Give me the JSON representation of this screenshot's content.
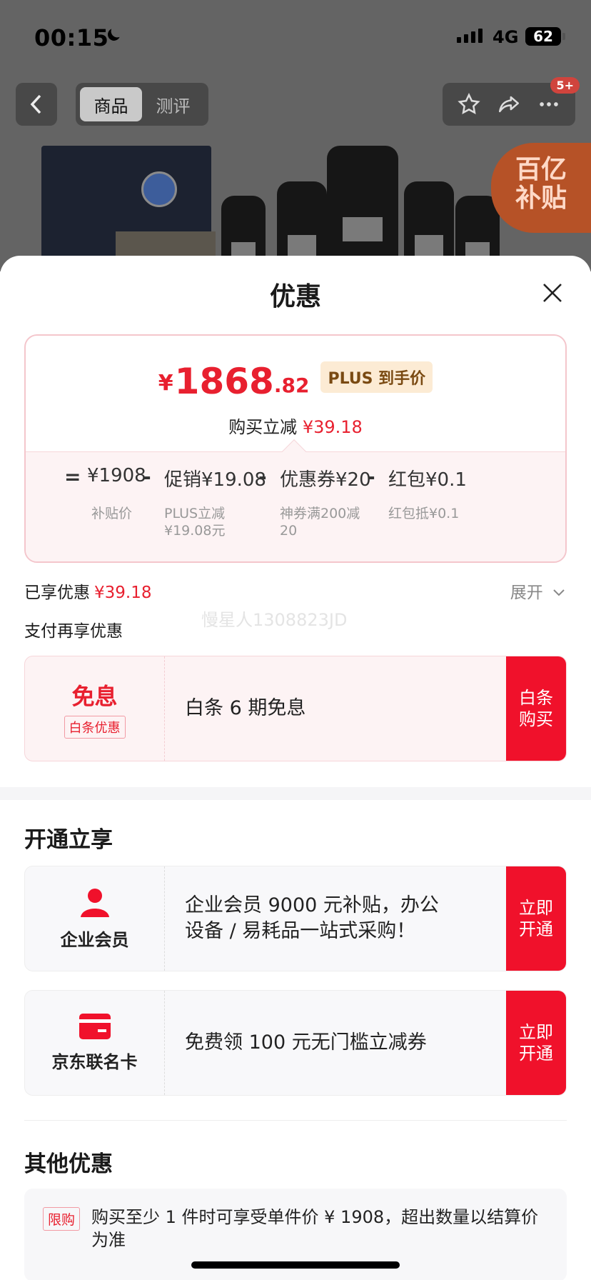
{
  "status_bar": {
    "time": "00:15",
    "network": "4G",
    "battery": "62"
  },
  "nav": {
    "tabs": [
      {
        "label": "商品"
      },
      {
        "label": "测评"
      }
    ],
    "message_badge": "5+"
  },
  "banner": {
    "subsidy_line1": "百亿",
    "subsidy_line2": "补贴"
  },
  "sheet": {
    "title": "优惠",
    "price": {
      "currency": "¥",
      "integer": "1868",
      "decimal": ".82",
      "tag": "PLUS 到手价",
      "reduce_label": "购买立减",
      "reduce_value": "¥39.18"
    },
    "breakdown": [
      {
        "op": "=",
        "amount": "¥1908",
        "desc": "补贴价"
      },
      {
        "op": "-",
        "amount": "促销¥19.08",
        "desc": "PLUS立减\n¥19.08元"
      },
      {
        "op": "-",
        "amount": "优惠券¥20",
        "desc": "神券满200减\n20"
      },
      {
        "op": "-",
        "amount": "红包¥0.1",
        "desc": "红包抵¥0.1"
      }
    ],
    "enjoyed_label": "已享优惠",
    "enjoyed_value": "¥39.18",
    "expand_label": "展开",
    "watermark": "慢星人1308823JD",
    "pay_more_label": "支付再享优惠",
    "pay_offer": {
      "title": "免息",
      "tag": "白条优惠",
      "desc": "白条 6 期免息",
      "cta": "白条\n购买"
    },
    "open_section_title": "开通立享",
    "open_offers": [
      {
        "label": "企业会员",
        "desc": "企业会员 9000 元补贴，办公设备 / 易耗品一站式采购！",
        "cta": "立即\n开通"
      },
      {
        "label": "京东联名卡",
        "desc": "免费领 100 元无门槛立减券",
        "cta": "立即\n开通"
      }
    ],
    "other_section_title": "其他优惠",
    "other": {
      "tag": "限购",
      "text": "购买至少 1 件时可享受单件价 ¥ 1908，超出数量以结算价为准"
    }
  },
  "colors": {
    "accent": "#e8202f",
    "cta": "#f0112b",
    "plus_tag_bg": "#fcebd4"
  }
}
